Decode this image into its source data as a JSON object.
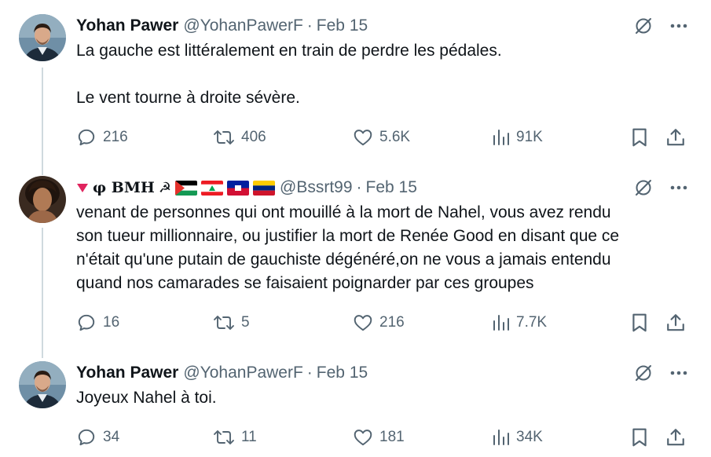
{
  "tweets": [
    {
      "author_name": "Yohan Pawer",
      "handle": "@YohanPawerF",
      "separator": "·",
      "date": "Feb 15",
      "text": "La gauche est littéralement en train de perdre les pédales.\n\nLe vent tourne à droite sévère.",
      "replies": "216",
      "reposts": "406",
      "likes": "5.6K",
      "views": "91K"
    },
    {
      "author_name": "φ BMH",
      "name_decorations": [
        "red-triangle",
        "hammer-sickle",
        "flag-palestine",
        "flag-lebanon",
        "flag-haiti",
        "flag-venezuela"
      ],
      "hammer_sickle_glyph": "☭",
      "handle": "@Bssrt99",
      "separator": "·",
      "date": "Feb 15",
      "text": "venant de personnes qui ont mouillé à la mort de Nahel, vous avez rendu\nson tueur millionnaire, ou justifier la mort de Renée Good en disant que ce\nn'était qu'une putain de gauchiste dégénéré,on ne vous a jamais entendu\nquand nos camarades se faisaient poignarder par ces groupes",
      "replies": "16",
      "reposts": "5",
      "likes": "216",
      "views": "7.7K"
    },
    {
      "author_name": "Yohan Pawer",
      "handle": "@YohanPawerF",
      "separator": "·",
      "date": "Feb 15",
      "text": "Joyeux Nahel à toi.",
      "replies": "34",
      "reposts": "11",
      "likes": "181",
      "views": "34K"
    }
  ],
  "colors": {
    "text": "#0f1419",
    "secondary": "#536471",
    "thread_line": "#cfd9de"
  }
}
